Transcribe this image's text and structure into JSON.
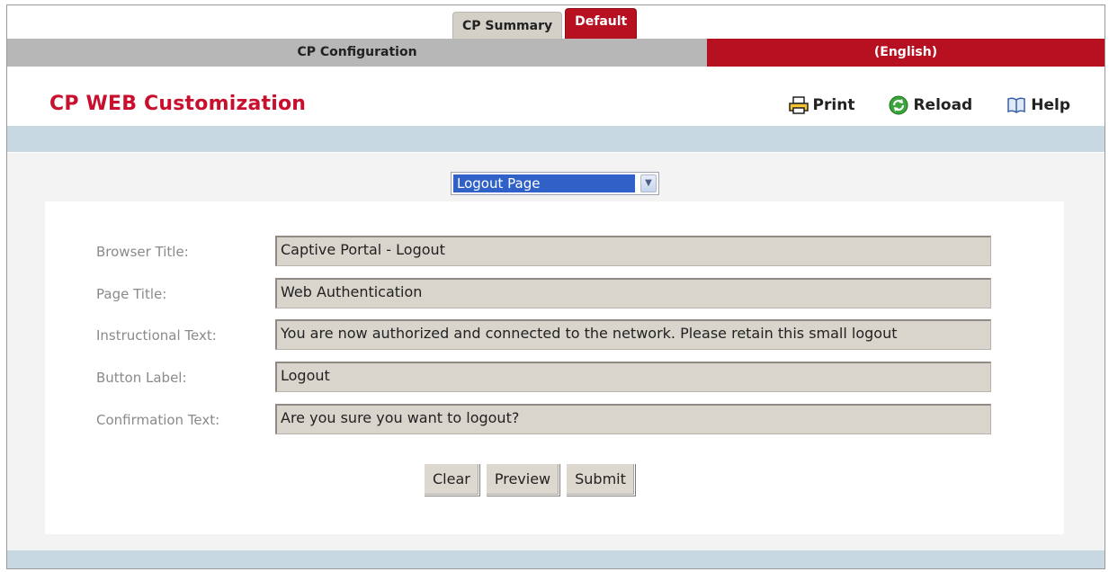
{
  "tabs": {
    "summary": "CP Summary",
    "default": "Default"
  },
  "config_bar": {
    "left": "CP Configuration",
    "right": "(English)"
  },
  "header": {
    "title": "CP WEB Customization",
    "print": "Print",
    "reload": "Reload",
    "help": "Help"
  },
  "page_select": {
    "value": "Logout Page"
  },
  "form": {
    "browser_title": {
      "label": "Browser Title:",
      "value": "Captive Portal - Logout"
    },
    "page_title": {
      "label": "Page Title:",
      "value": "Web Authentication"
    },
    "instructional_text": {
      "label": "Instructional Text:",
      "value": "You are now authorized and connected to the network. Please retain this small logout"
    },
    "button_label": {
      "label": "Button Label:",
      "value": "Logout"
    },
    "confirmation_text": {
      "label": "Confirmation Text:",
      "value": "Are you sure you want to logout?"
    }
  },
  "buttons": {
    "clear": "Clear",
    "preview": "Preview",
    "submit": "Submit"
  },
  "colors": {
    "accent": "#b71021",
    "title": "#c8102e",
    "bar_blue": "#c7d8e3",
    "select_highlight": "#2f61c9"
  },
  "icons": {
    "print": "printer-icon",
    "reload": "reload-icon",
    "help": "help-book-icon",
    "dropdown": "chevron-down-icon"
  }
}
